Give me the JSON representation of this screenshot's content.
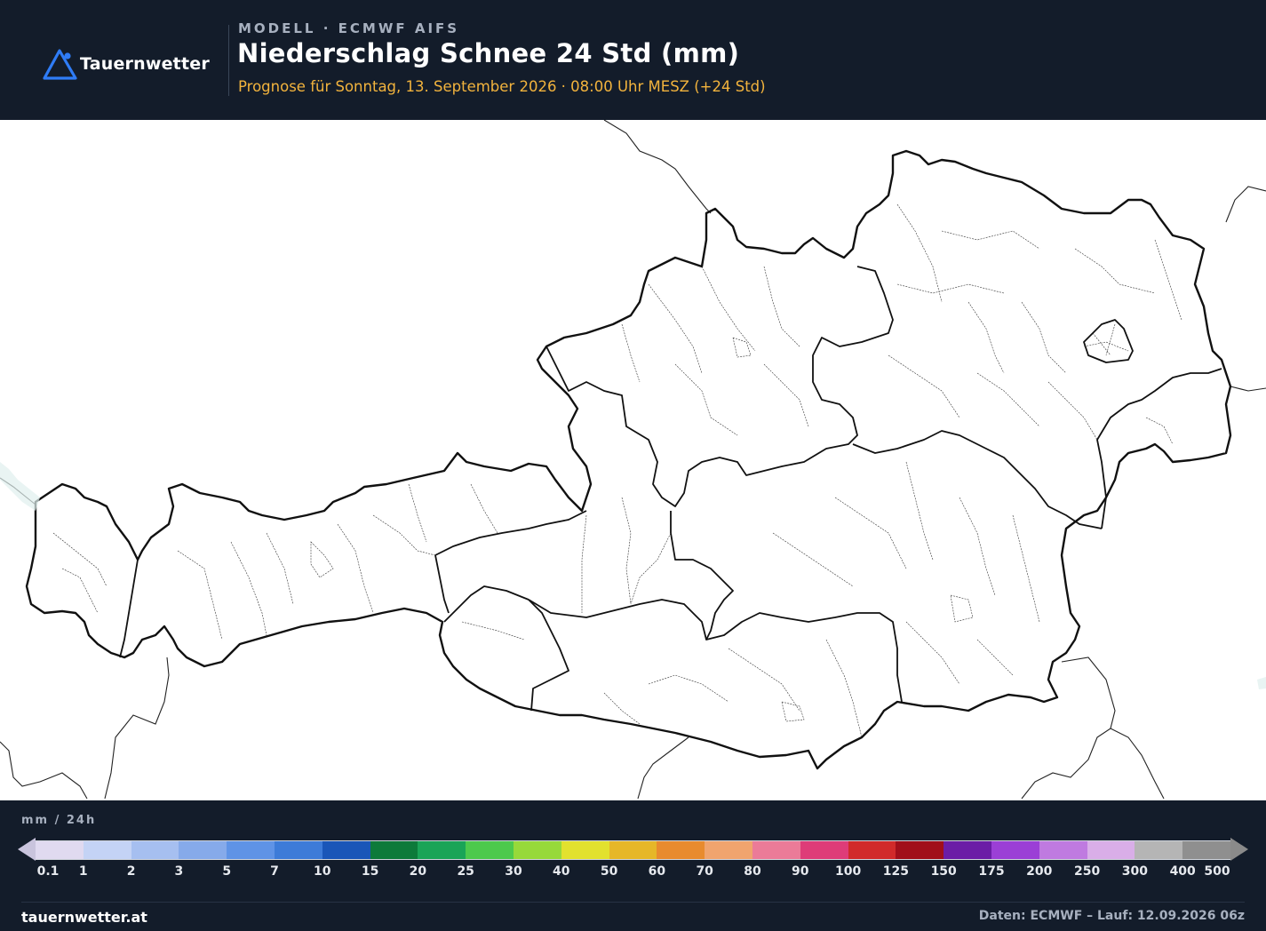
{
  "brand": {
    "name": "Tauernwetter",
    "website": "tauernwetter.at"
  },
  "header": {
    "model": "MODELL · ECMWF AIFS",
    "title": "Niederschlag Schnee 24 Std (mm)",
    "subtitle": "Prognose für Sonntag, 13. September 2026 · 08:00 Uhr MESZ  (+24 Std)"
  },
  "legend": {
    "unit": "mm / 24h",
    "ticks": [
      "0.1",
      "1",
      "2",
      "3",
      "5",
      "7",
      "10",
      "15",
      "20",
      "25",
      "30",
      "40",
      "50",
      "60",
      "70",
      "80",
      "90",
      "100",
      "125",
      "150",
      "175",
      "200",
      "250",
      "300",
      "400",
      "500"
    ],
    "colors": [
      "#e0daf0",
      "#c4d3f5",
      "#a6bff0",
      "#86aaea",
      "#5f93e6",
      "#3d7bd8",
      "#1a56b8",
      "#0d7a3a",
      "#1aa457",
      "#4dc94c",
      "#97d93a",
      "#e2e12e",
      "#e6b728",
      "#e88b2e",
      "#f0a46e",
      "#eb7b98",
      "#de3c78",
      "#d12a2a",
      "#a10f1a",
      "#6b1da6",
      "#9b3fd6",
      "#bf7ae0",
      "#d9aee8",
      "#b5b5b5",
      "#8f8f8f"
    ],
    "accent_colors": {
      "arrow_low": "#c9c4dd",
      "arrow_high": "#8a8a8a"
    }
  },
  "footer": {
    "site": "tauernwetter.at",
    "credit": "Daten: ECMWF – Lauf: 12.09.2026 06z"
  },
  "map": {
    "region": "Austria",
    "precipitation_visible": false
  }
}
